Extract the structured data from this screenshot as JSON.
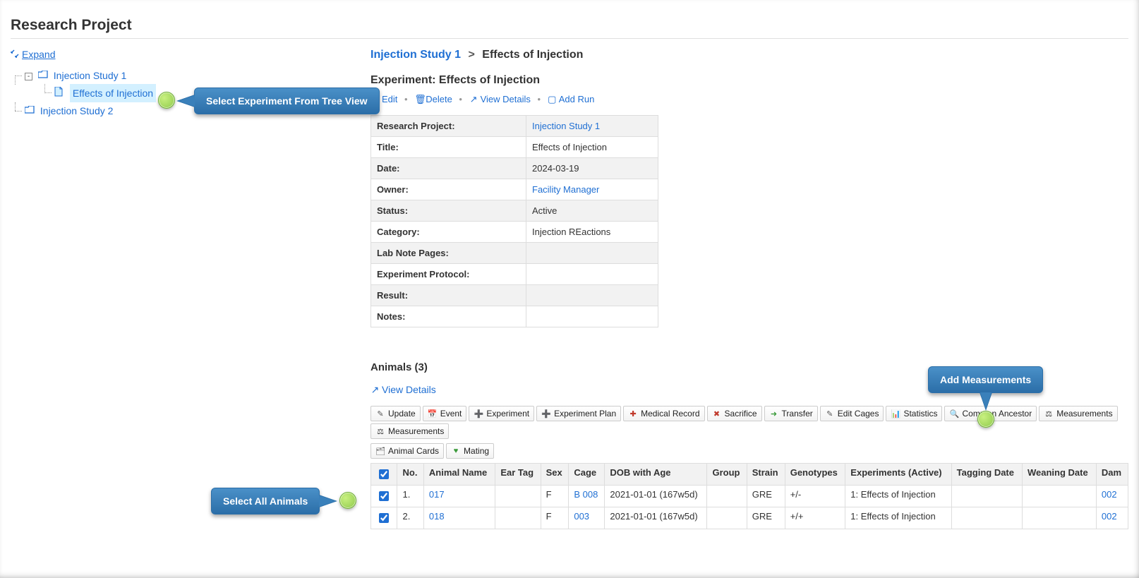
{
  "pageTitle": "Research Project",
  "sidebar": {
    "expand": "Expand",
    "items": [
      {
        "label": "Injection Study 1",
        "children": [
          {
            "label": "Effects of Injection",
            "selected": true
          }
        ]
      },
      {
        "label": "Injection Study 2"
      }
    ]
  },
  "breadcrumb": {
    "parent": "Injection Study 1",
    "current": "Effects of Injection"
  },
  "experiment": {
    "heading": "Experiment: Effects of Injection",
    "actions": {
      "edit": "Edit",
      "delete": "Delete",
      "viewDetails": "View Details",
      "addRun": "Add Run"
    },
    "meta": [
      {
        "label": "Research Project:",
        "value": "Injection Study 1",
        "link": true
      },
      {
        "label": "Title:",
        "value": "Effects of Injection"
      },
      {
        "label": "Date:",
        "value": "2024-03-19"
      },
      {
        "label": "Owner:",
        "value": "Facility Manager",
        "link": true
      },
      {
        "label": "Status:",
        "value": "Active"
      },
      {
        "label": "Category:",
        "value": "Injection REactions"
      },
      {
        "label": "Lab Note Pages:",
        "value": ""
      },
      {
        "label": "Experiment Protocol:",
        "value": ""
      },
      {
        "label": "Result:",
        "value": ""
      },
      {
        "label": "Notes:",
        "value": ""
      }
    ]
  },
  "animals": {
    "heading": "Animals (3)",
    "viewDetails": "View Details",
    "toolbar": [
      "Update",
      "Event",
      "Experiment",
      "Experiment Plan",
      "Medical Record",
      "Sacrifice",
      "Transfer",
      "Edit Cages",
      "Statistics",
      "Common Ancestor",
      "Measurements",
      "Measurements",
      "Animal Cards",
      "Mating"
    ],
    "columns": [
      "",
      "No.",
      "Animal Name",
      "Ear Tag",
      "Sex",
      "Cage",
      "DOB with Age",
      "Group",
      "Strain",
      "Genotypes",
      "Experiments (Active)",
      "Tagging Date",
      "Weaning Date",
      "Dam"
    ],
    "rows": [
      {
        "no": "1.",
        "name": "017",
        "ear": "",
        "sex": "F",
        "cage": "B 008",
        "dob": "2021-01-01 (167w5d)",
        "group": "",
        "strain": "GRE",
        "geno": "+/-",
        "exp": "1: Effects of Injection",
        "tag": "",
        "wean": "",
        "dam": "002",
        "damStrike": true
      },
      {
        "no": "2.",
        "name": "018",
        "ear": "",
        "sex": "F",
        "cage": "003",
        "dob": "2021-01-01 (167w5d)",
        "group": "",
        "strain": "GRE",
        "geno": "+/+",
        "exp": "1: Effects of Injection",
        "tag": "",
        "wean": "",
        "dam": "002",
        "damStrike": true
      }
    ]
  },
  "callouts": {
    "tree": "Select Experiment From Tree View",
    "selectAll": "Select All Animals",
    "addMeas": "Add Measurements"
  }
}
